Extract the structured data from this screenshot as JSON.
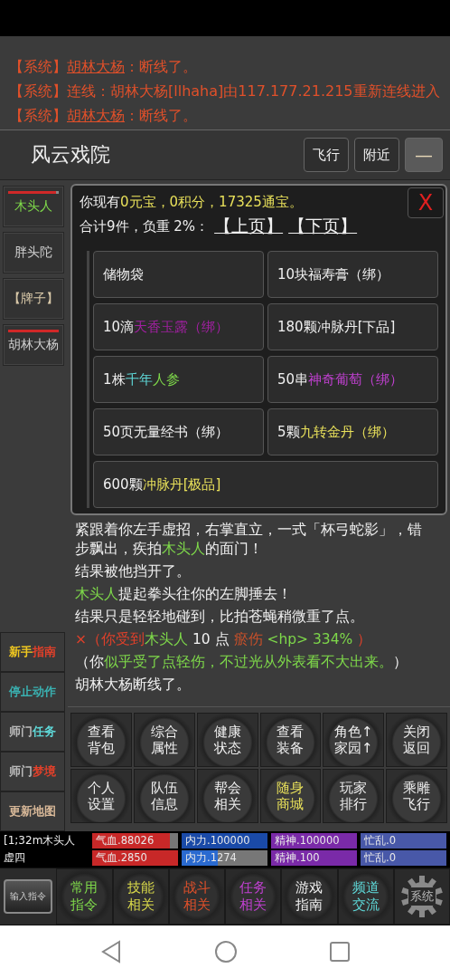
{
  "system_messages": [
    {
      "segments": [
        {
          "text": "【系统】",
          "color": "#e0502a",
          "underline": false
        },
        {
          "text": "胡林大杨",
          "color": "#e0502a",
          "underline": true
        },
        {
          "text": "：断线了。",
          "color": "#e0502a",
          "underline": false
        }
      ]
    },
    {
      "segments": [
        {
          "text": "【系统】连线：胡林大杨[llhaha]由117.177.21.215重新连线进入",
          "color": "#e0502a",
          "underline": false
        }
      ]
    },
    {
      "segments": [
        {
          "text": "【系统】",
          "color": "#e0502a",
          "underline": false
        },
        {
          "text": "胡林大杨",
          "color": "#e0502a",
          "underline": true
        },
        {
          "text": "：断线了。",
          "color": "#e0502a",
          "underline": false
        }
      ]
    }
  ],
  "location": {
    "title": "风云戏院",
    "buttons": [
      {
        "label": "飞行",
        "kind": "text"
      },
      {
        "label": "附近",
        "kind": "text"
      },
      {
        "label": "—",
        "kind": "minimize"
      }
    ]
  },
  "npcs": [
    {
      "name": "木头人",
      "color": "#7ed84a",
      "level": 0.94
    },
    {
      "name": "胖头陀",
      "color": "#cfcfcf"
    },
    {
      "name": "【牌子】",
      "color": "#d8c8a8"
    },
    {
      "name": "胡林大杨",
      "color": "#d0d0d0",
      "level": 1
    }
  ],
  "inventory": {
    "balance": [
      {
        "text": "你现有",
        "color": "#f0f0f0"
      },
      {
        "text": "0元宝，0积分，17325通宝。",
        "color": "#e8e05a"
      }
    ],
    "summary": "合计9件，负重 2%：",
    "pages": [
      "【上页】",
      "【下页】"
    ],
    "close": "X",
    "items": [
      {
        "segments": [
          {
            "text": "储物袋",
            "color": "#f0f0f0"
          }
        ]
      },
      {
        "segments": [
          {
            "text": "10块福寿膏（绑）",
            "color": "#f0f0f0"
          }
        ]
      },
      {
        "segments": [
          {
            "text": "10滴",
            "color": "#f0f0f0"
          },
          {
            "text": "天香玉露（绑）",
            "color": "#a020a0"
          }
        ]
      },
      {
        "segments": [
          {
            "text": "180颗冲脉丹[下品]",
            "color": "#f0f0f0"
          }
        ]
      },
      {
        "segments": [
          {
            "text": "1株",
            "color": "#f0f0f0"
          },
          {
            "text": "千年",
            "color": "#5ed8d8"
          },
          {
            "text": "人参",
            "color": "#7ed84a"
          }
        ]
      },
      {
        "segments": [
          {
            "text": "50串",
            "color": "#f0f0f0"
          },
          {
            "text": "神奇葡萄（绑）",
            "color": "#c040d0"
          }
        ]
      },
      {
        "segments": [
          {
            "text": "50页无量经书（绑）",
            "color": "#f0f0f0"
          }
        ]
      },
      {
        "segments": [
          {
            "text": "5颗",
            "color": "#f0f0f0"
          },
          {
            "text": "九转金丹（绑）",
            "color": "#e8e05a"
          }
        ]
      },
      {
        "segments": [
          {
            "text": "600颗",
            "color": "#f0f0f0"
          },
          {
            "text": "冲脉丹[极品]",
            "color": "#e8e05a"
          }
        ]
      }
    ]
  },
  "log": [
    {
      "segments": [
        {
          "text": "紧跟着你左手虚招，右掌直立，一式「杯弓蛇影」，错步飘出，疾拍",
          "color": "#f0f0f0"
        },
        {
          "text": "木头人",
          "color": "#7ed84a"
        },
        {
          "text": "的面门！",
          "color": "#f0f0f0"
        }
      ]
    },
    {
      "segments": [
        {
          "text": "结果被他挡开了。",
          "color": "#f0f0f0"
        }
      ]
    },
    {
      "segments": [
        {
          "text": "木头人",
          "color": "#7ed84a"
        },
        {
          "text": "提起拳头往你的左脚捶去！",
          "color": "#f0f0f0"
        }
      ]
    },
    {
      "segments": [
        {
          "text": "结果只是轻轻地碰到，比拍苍蝇稍微重了点。",
          "color": "#f0f0f0"
        }
      ]
    },
    {
      "segments": [
        {
          "text": " ×（你受到",
          "color": "#e0402a"
        },
        {
          "text": "木头人",
          "color": "#7ed84a"
        },
        {
          "text": " 10 点 ",
          "color": "#f0f0f0"
        },
        {
          "text": "瘀伤",
          "color": "#c8502a"
        },
        {
          "text": "  <hp> 334% ",
          "color": "#7ed84a"
        },
        {
          "text": "）",
          "color": "#e0402a"
        }
      ]
    },
    {
      "segments": [
        {
          "text": "（你",
          "color": "#f0f0f0"
        },
        {
          "text": "似乎受了点轻伤，不过光从外表看不大出来。",
          "color": "#7ed84a"
        },
        {
          "text": "）",
          "color": "#f0f0f0"
        }
      ]
    },
    {
      "segments": [
        {
          "text": "胡林大杨断线了。",
          "color": "#f0f0f0"
        }
      ]
    }
  ],
  "side_commands": [
    {
      "segments": [
        {
          "text": "新手",
          "color": "#f0c820"
        },
        {
          "text": "指南",
          "color": "#e0402a"
        }
      ]
    },
    {
      "segments": [
        {
          "text": "停止动作",
          "color": "#3ab0b0"
        }
      ]
    },
    {
      "segments": [
        {
          "text": "师门",
          "color": "#bbbbbb"
        },
        {
          "text": "任务",
          "color": "#5ed8d8"
        }
      ]
    },
    {
      "segments": [
        {
          "text": "师门",
          "color": "#bbbbbb"
        },
        {
          "text": "梦境",
          "color": "#e0402a"
        }
      ]
    },
    {
      "segments": [
        {
          "text": "更新地图",
          "color": "#d8b898"
        }
      ]
    }
  ],
  "actions": [
    {
      "label": "查看背包",
      "color": "#f0f0f0"
    },
    {
      "label": "综合属性",
      "color": "#f0f0f0"
    },
    {
      "label": "健康状态",
      "color": "#f0f0f0"
    },
    {
      "label": "查看装备",
      "color": "#f0f0f0"
    },
    {
      "label": "角色↑家园↑",
      "color": "#f0f0f0"
    },
    {
      "label": "关闭返回",
      "color": "#f0f0f0"
    },
    {
      "label": "个人设置",
      "color": "#f0f0f0"
    },
    {
      "label": "队伍信息",
      "color": "#f0f0f0"
    },
    {
      "label": "帮会相关",
      "color": "#f0f0f0"
    },
    {
      "label": "随身商城",
      "color": "#e8e05a"
    },
    {
      "label": "玩家排行",
      "color": "#f0f0f0"
    },
    {
      "label": "乘雕飞行",
      "color": "#f0f0f0"
    }
  ],
  "stats": [
    {
      "name": "[1;32m木头人",
      "bars": [
        {
          "label": "气血.88026",
          "color": "#c82828",
          "level": 0.9
        },
        {
          "label": "内力.100000",
          "color": "#1a4aa8",
          "level": 1
        },
        {
          "label": "精神.100000",
          "color": "#7a2aa8",
          "level": 1
        },
        {
          "label": "忙乱.0",
          "color": "#4858a8",
          "level": 1
        }
      ]
    },
    {
      "name": "虚四",
      "bars": [
        {
          "label": "气血.2850",
          "color": "#c82828",
          "level": 1
        },
        {
          "label": "内力.1274",
          "color": "#2a6ad0",
          "level": 0.42
        },
        {
          "label": "精神.100",
          "color": "#7a2aa8",
          "level": 1
        },
        {
          "label": "忙乱.0",
          "color": "#4858a8",
          "level": 1
        }
      ]
    }
  ],
  "bottom_menu": [
    {
      "label": "输入指令",
      "kind": "input"
    },
    {
      "label": "常用指令",
      "kind": "text",
      "color": "#7ed84a"
    },
    {
      "label": "技能相关",
      "kind": "text",
      "color": "#d8d84a"
    },
    {
      "label": "战斗相关",
      "kind": "text",
      "color": "#e0502a"
    },
    {
      "label": "任务相关",
      "kind": "text",
      "color": "#c040d0"
    },
    {
      "label": "游戏指南",
      "kind": "text",
      "color": "#f0f0f0"
    },
    {
      "label": "频道交流",
      "kind": "text",
      "color": "#5ed8d8"
    },
    {
      "label": "系统",
      "kind": "gear"
    }
  ]
}
